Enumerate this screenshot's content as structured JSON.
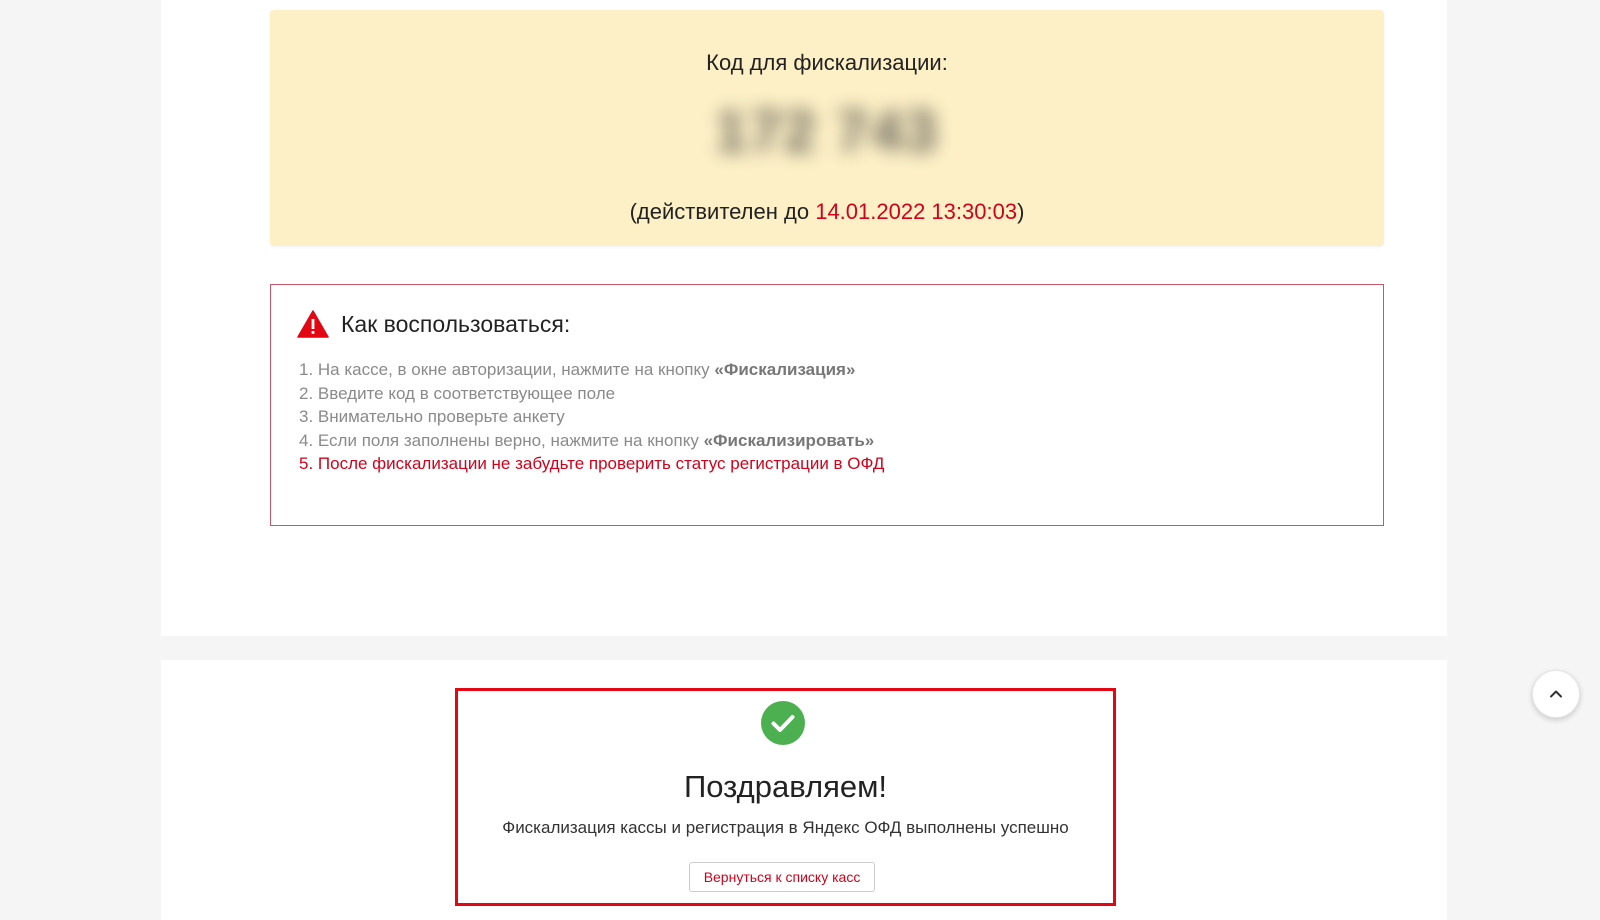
{
  "code_panel": {
    "title": "Код для фискализации:",
    "code": "172 743",
    "valid_prefix": "(действителен до ",
    "valid_date": "14.01.2022 13:30:03",
    "valid_suffix": ")"
  },
  "howto": {
    "title": "Как воспользоваться:",
    "icon": "warning-triangle-icon",
    "steps": [
      {
        "text": "1. На кассе, в окне авторизации, нажмите на кнопку ",
        "bold": "«Фискализация»"
      },
      {
        "text": "2. Введите код в соответствующее поле"
      },
      {
        "text": "3. Внимательно проверьте анкету"
      },
      {
        "text": "4. Если поля заполнены верно, нажмите на кнопку ",
        "bold": "«Фискализировать»"
      },
      {
        "text": "5. После фискализации не забудьте проверить статус регистрации в ОФД"
      }
    ]
  },
  "success": {
    "icon": "check-circle-icon",
    "title": "Поздравляем!",
    "message": "Фискализация кассы и регистрация в Яндекс ОФД выполнены успешно",
    "back_button_label": "Вернуться к списку касс"
  },
  "scroll_top": {
    "icon": "chevron-up-icon"
  },
  "colors": {
    "accent_red": "#d0021b",
    "code_background": "#fdf0c6",
    "success_green": "#4caf50"
  }
}
